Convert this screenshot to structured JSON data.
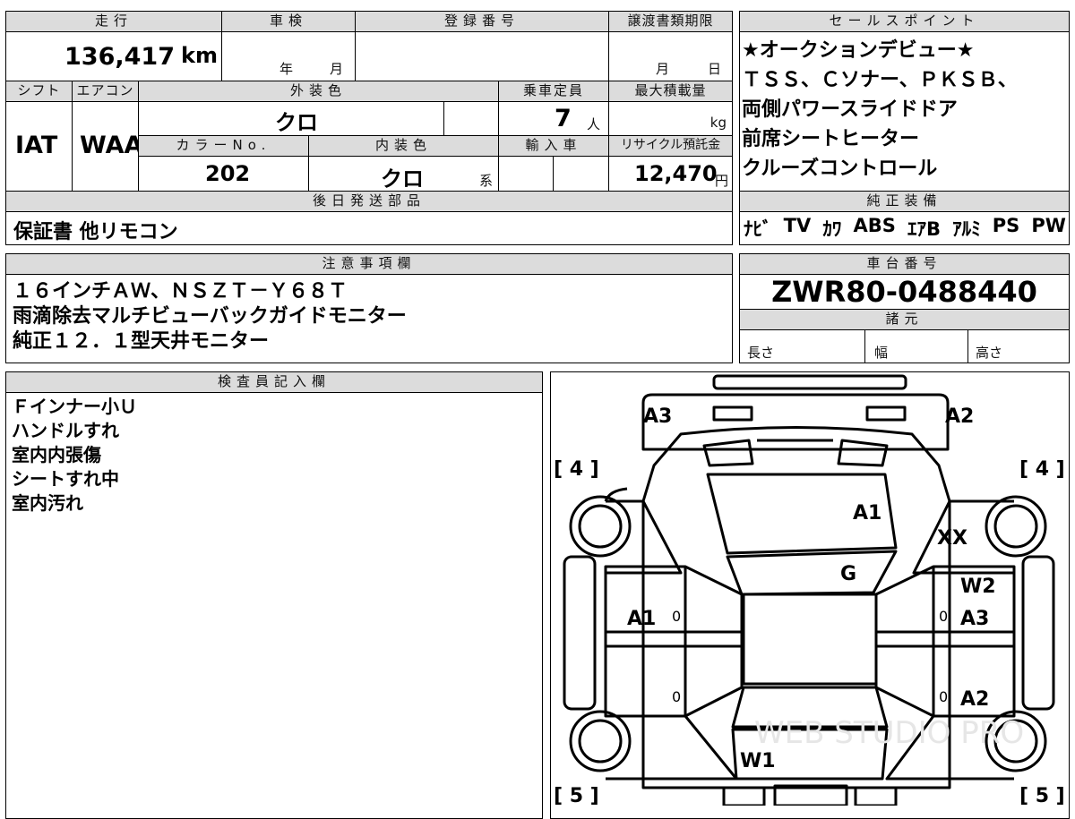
{
  "headers": {
    "mileage": "走行",
    "inspection": "車検",
    "registration": "登録番号",
    "transfer_deadline": "譲渡書類期限",
    "shift": "シフト",
    "aircon": "エアコン",
    "exterior_color": "外装色",
    "capacity": "乗車定員",
    "max_load": "最大積載量",
    "color_no": "カラーNo.",
    "interior_color": "内装色",
    "import": "輸入車",
    "recycle": "リサイクル預託金",
    "later_parts": "後日発送部品",
    "sales_points": "セールスポイント",
    "genuine_equipment": "純正装備",
    "notes": "注意事項欄",
    "chassis_no": "車台番号",
    "specs": "諸元",
    "inspector": "検査員記入欄"
  },
  "values": {
    "mileage": "136,417",
    "mileage_unit": "km",
    "year_unit": "年",
    "month_unit": "月",
    "transfer_month": "月",
    "transfer_day": "日",
    "shift": "IAT",
    "aircon": "WAA",
    "exterior_color": "クロ",
    "capacity": "7",
    "capacity_unit": "人",
    "load_unit": "kg",
    "color_no": "202",
    "interior_color": "クロ",
    "interior_suffix": "系",
    "recycle": "12,470",
    "recycle_unit": "円",
    "later_parts": "保証書 他リモコン",
    "chassis_no": "ZWR80-0488440",
    "length_label": "長さ",
    "width_label": "幅",
    "height_label": "高さ"
  },
  "sales_points": [
    "★オークションデビュー★",
    "ＴＳＳ、Ｃソナー、ＰＫＳＢ、",
    "両側パワースライドドア",
    "前席シートヒーター",
    "クルーズコントロール"
  ],
  "genuine_equipment": [
    "ﾅﾋﾞ",
    "TV",
    "ｶﾜ",
    "ABS",
    "ｴｱB",
    "ｱﾙﾐ",
    "PS",
    "PW"
  ],
  "notes": [
    "１６インチＡＷ、ＮＳＺＴ－Ｙ６８Ｔ",
    "雨滴除去マルチビューバックガイドモニター",
    "純正１２．１型天井モニター"
  ],
  "inspector_notes": [
    "Ｆインナー小Ｕ",
    "ハンドルすれ",
    "室内内張傷",
    "シートすれ中",
    "室内汚れ"
  ],
  "diagram": {
    "tire_front_left": "[ 4 ]",
    "tire_front_right": "[ 4 ]",
    "tire_rear_left": "[ 5 ]",
    "tire_rear_right": "[ 5 ]",
    "front_left_corner": "A3",
    "front_right_corner": "A2",
    "hood": "A1",
    "right_fender": "XX",
    "windshield": "G",
    "right_front_door_upper": "W2",
    "left_front_door": "A1",
    "right_front_door": "A3",
    "right_rear_door": "A2",
    "rear_glass": "W1",
    "zero_mark": "0"
  },
  "watermark": "WEB STUDIO PRO"
}
